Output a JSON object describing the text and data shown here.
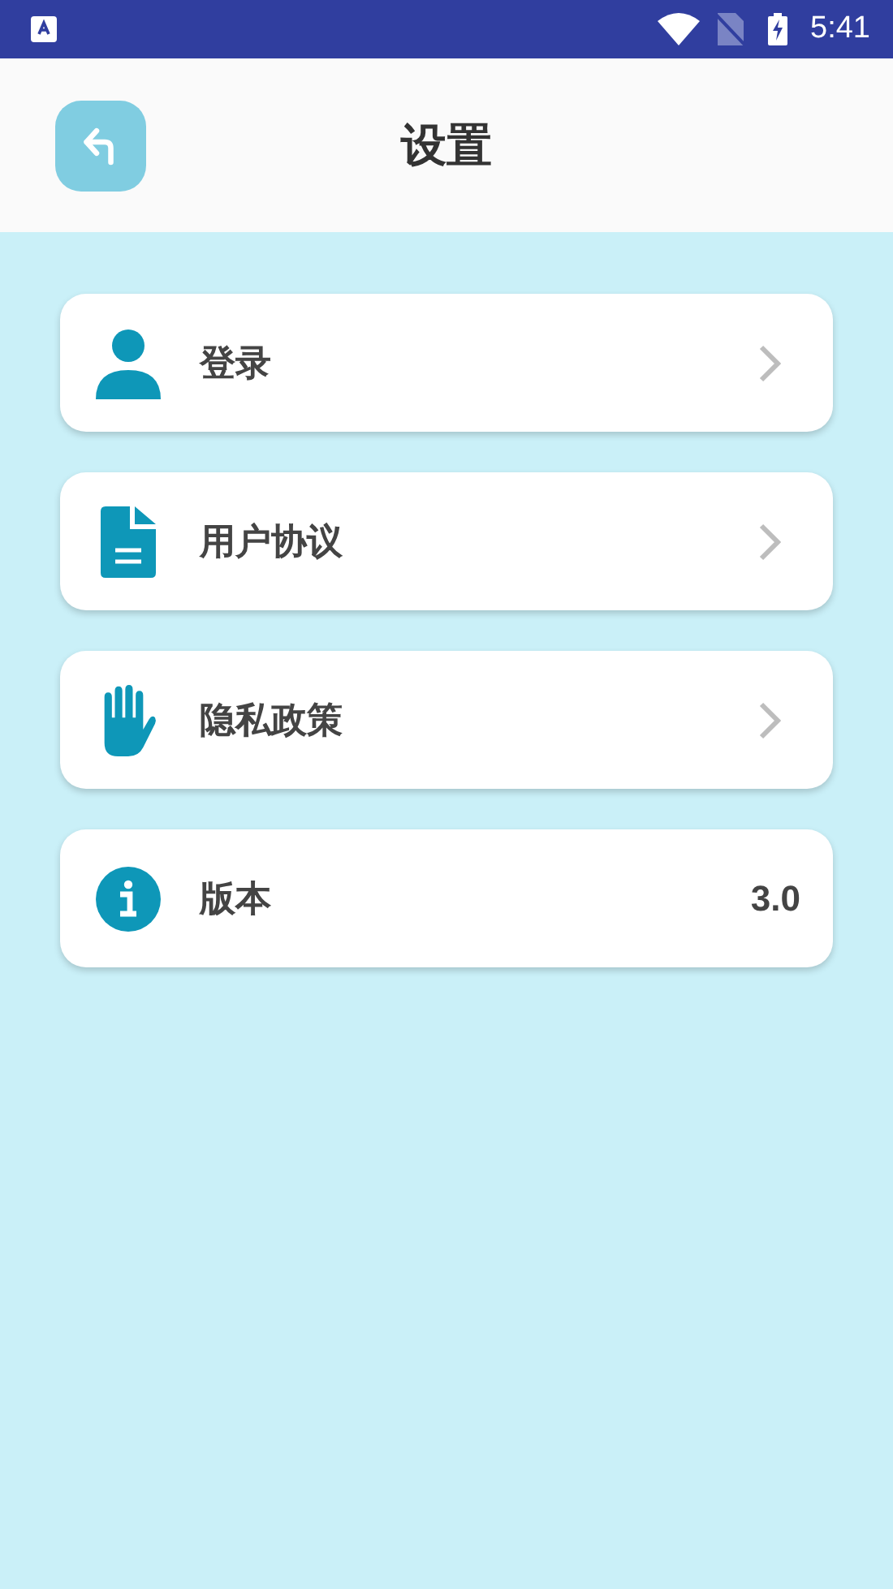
{
  "status_bar": {
    "time": "5:41"
  },
  "header": {
    "title": "设置"
  },
  "items": [
    {
      "kind": "link",
      "label": "登录"
    },
    {
      "kind": "link",
      "label": "用户协议"
    },
    {
      "kind": "link",
      "label": "隐私政策"
    },
    {
      "kind": "value",
      "label": "版本",
      "value": "3.0"
    }
  ]
}
